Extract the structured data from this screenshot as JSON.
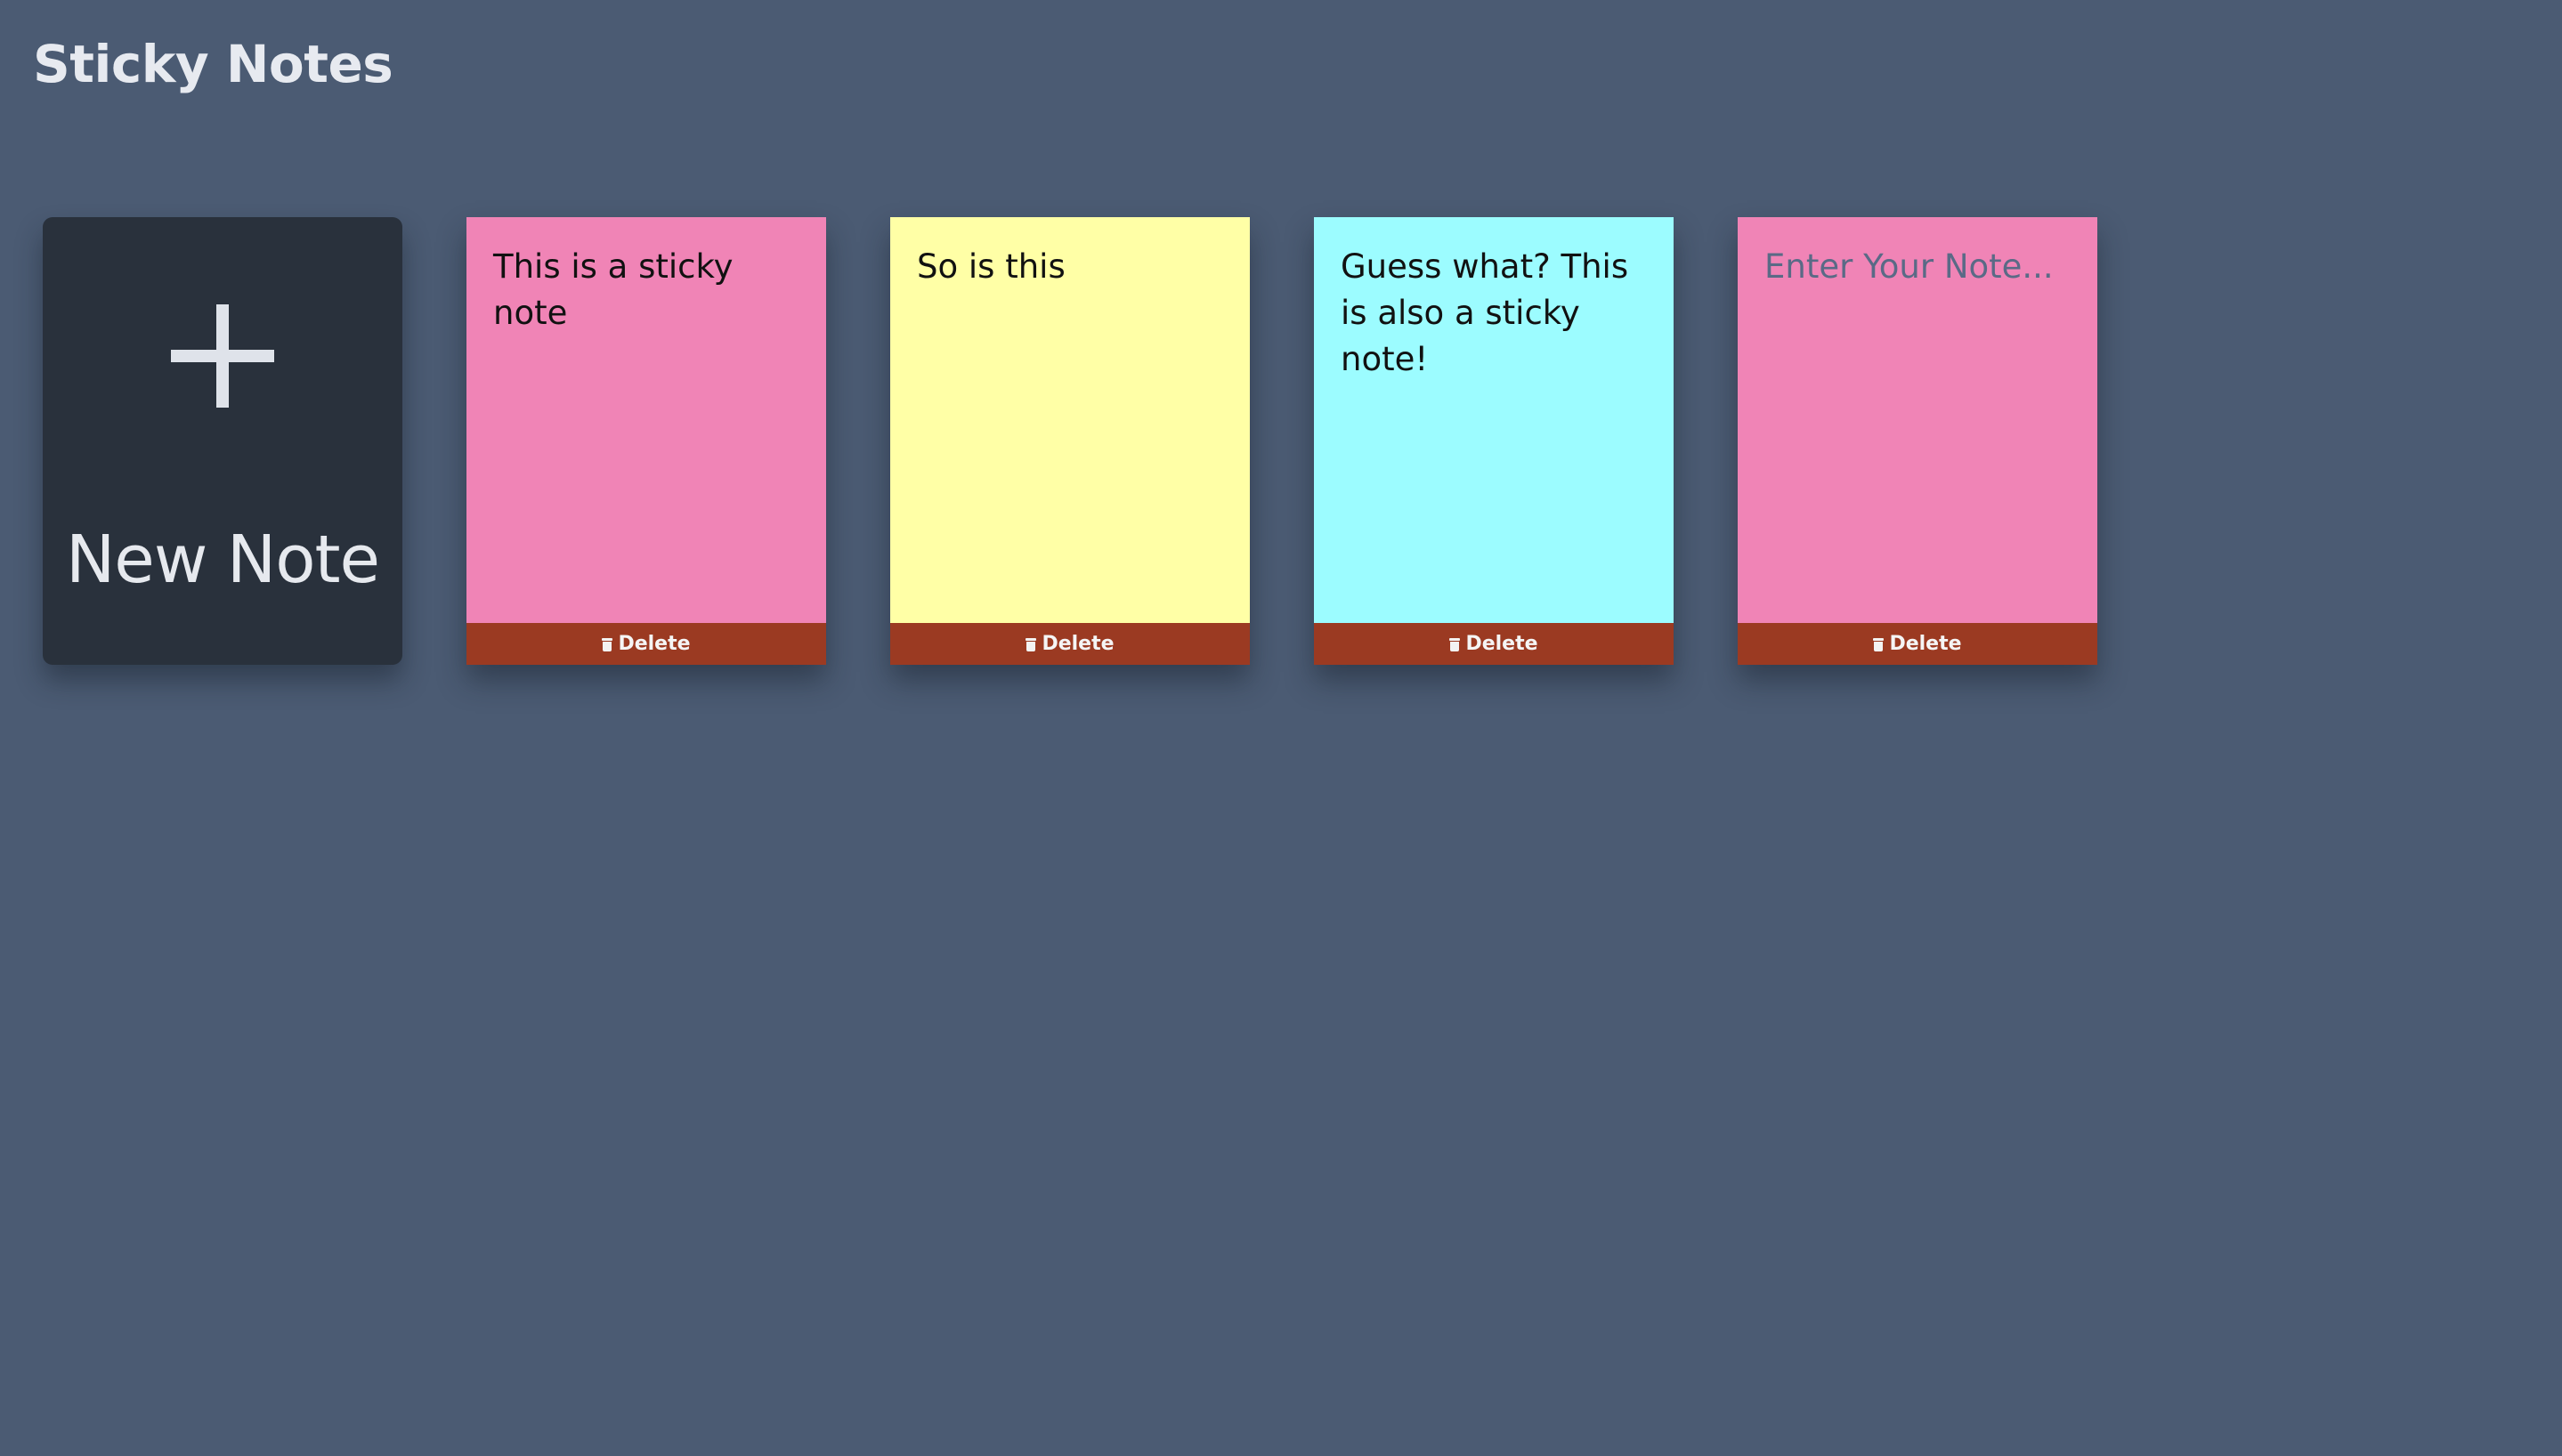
{
  "app": {
    "title": "Sticky Notes"
  },
  "new_note": {
    "label": "New Note",
    "icon": "plus-icon"
  },
  "notes": [
    {
      "text": "This is a sticky note",
      "placeholder": "",
      "color": "#f084b6",
      "delete_label": "Delete",
      "delete_icon": "trash-icon"
    },
    {
      "text": "So is this",
      "placeholder": "",
      "color": "#ffffa6",
      "delete_label": "Delete",
      "delete_icon": "trash-icon"
    },
    {
      "text": "Guess what? This is also a sticky note!",
      "placeholder": "",
      "color": "#9cfcff",
      "delete_label": "Delete",
      "delete_icon": "trash-icon"
    },
    {
      "text": "",
      "placeholder": "Enter Your Note...",
      "color": "#f084b6",
      "delete_label": "Delete",
      "delete_icon": "trash-icon"
    }
  ],
  "colors": {
    "background": "#4b5b73",
    "new_note_card": "#29313c",
    "delete_bar": "#9b3a22"
  }
}
